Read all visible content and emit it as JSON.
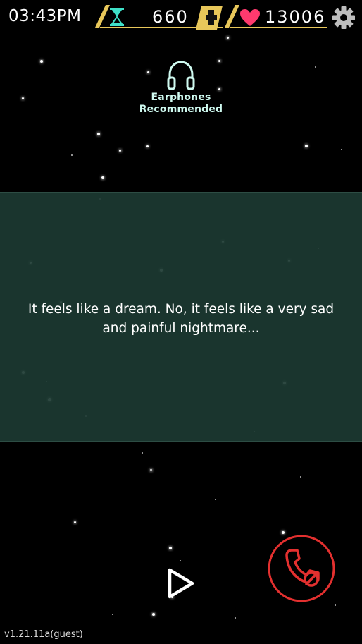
{
  "status_bar": {
    "clock": "03:43PM",
    "time_currency": {
      "icon": "hourglass-icon",
      "value": "660",
      "add_icon": "plus-icon"
    },
    "hearts": {
      "icon": "heart-icon",
      "value": "13006"
    },
    "settings_icon": "gear-icon"
  },
  "earphones_hint": {
    "icon": "headphones-icon",
    "line1": "Earphones",
    "line2": "Recommended"
  },
  "dialogue": {
    "text": "It feels like a dream. No, it feels like a very sad\nand painful nightmare..."
  },
  "controls": {
    "play_icon": "play-icon",
    "end_call_icon": "phone-hangup-icon"
  },
  "footer": {
    "version": "v1.21.11a(guest)"
  },
  "colors": {
    "accent_gold": "#e8c75a",
    "hourglass_teal": "#3fe0c8",
    "heart_pink": "#ff3a6e",
    "end_call_red": "#e3302f",
    "panel_green": "#1c3a32"
  }
}
